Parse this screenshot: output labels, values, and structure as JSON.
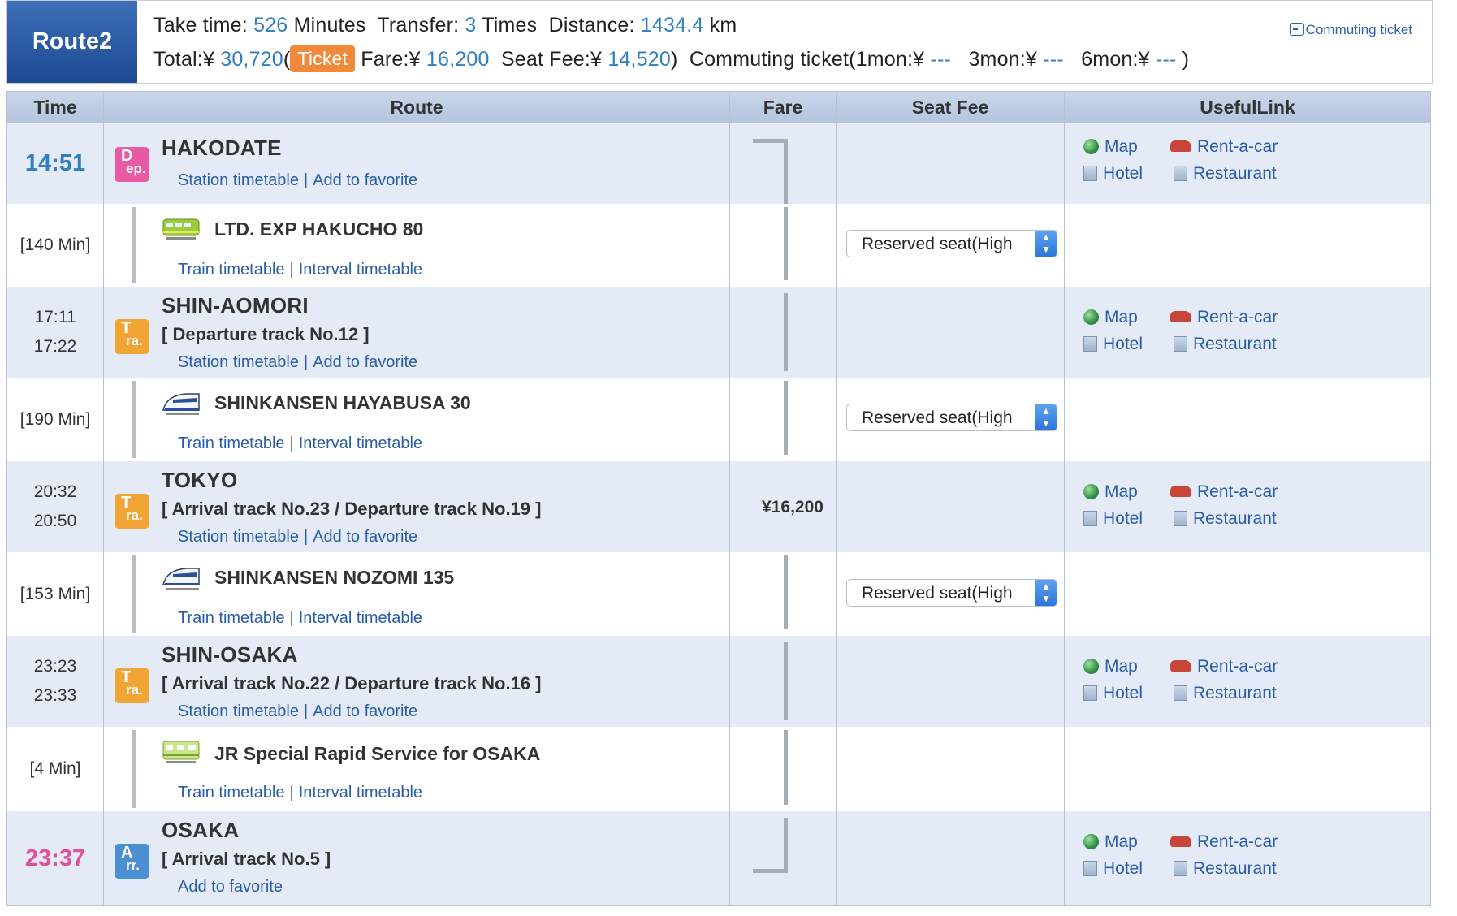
{
  "header": {
    "route_label": "Route2",
    "take_time_label": "Take time:",
    "take_time_value": "526",
    "take_time_unit": "Minutes",
    "transfer_label": "Transfer:",
    "transfer_value": "3",
    "transfer_unit": "Times",
    "distance_label": "Distance:",
    "distance_value": "1434.4",
    "distance_unit": "km",
    "total_label": "Total:¥",
    "total_value": "30,720",
    "ticket_button": "Ticket",
    "fare_label": "Fare:¥",
    "fare_value": "16,200",
    "seat_fee_label": "Seat Fee:¥",
    "seat_fee_value": "14,520",
    "commuting_prefix": "Commuting ticket(1mon:¥",
    "commuting_1mon": "---",
    "commuting_3mon_label": "3mon:¥",
    "commuting_3mon": "---",
    "commuting_6mon_label": "6mon:¥",
    "commuting_6mon": "---",
    "commuting_link": "Commuting ticket"
  },
  "columns": [
    "Time",
    "Route",
    "Fare",
    "Seat Fee",
    "UsefulLink"
  ],
  "common": {
    "station_timetable": "Station timetable",
    "add_to_favorite": "Add to favorite",
    "train_timetable": "Train timetable",
    "interval_timetable": "Interval timetable",
    "seat_option": "Reserved seat(High",
    "link_map": "Map",
    "link_rentacar": "Rent-a-car",
    "link_hotel": "Hotel",
    "link_restaurant": "Restaurant",
    "sep": "|"
  },
  "stations": [
    {
      "name": "HAKODATE",
      "badge_top": "D",
      "badge_bottom": "ep.",
      "time": "14:51"
    },
    {
      "name": "SHIN-AOMORI",
      "badge_top": "T",
      "badge_bottom": "ra.",
      "time1": "17:11",
      "time2": "17:22",
      "track": "[ Departure track No.12 ]"
    },
    {
      "name": "TOKYO",
      "badge_top": "T",
      "badge_bottom": "ra.",
      "time1": "20:32",
      "time2": "20:50",
      "track": "[ Arrival track No.23 / Departure track No.19 ]",
      "fare": "¥16,200"
    },
    {
      "name": "SHIN-OSAKA",
      "badge_top": "T",
      "badge_bottom": "ra.",
      "time1": "23:23",
      "time2": "23:33",
      "track": "[ Arrival track No.22 / Departure track No.16 ]"
    },
    {
      "name": "OSAKA",
      "badge_top": "A",
      "badge_bottom": "rr.",
      "time": "23:37",
      "track": "[ Arrival track No.5 ]"
    }
  ],
  "legs": [
    {
      "duration": "[140 Min]",
      "train": "LTD. EXP HAKUCHO 80",
      "icon": "ltd-express-train-icon"
    },
    {
      "duration": "[190 Min]",
      "train": "SHINKANSEN HAYABUSA 30",
      "icon": "shinkansen-icon"
    },
    {
      "duration": "[153 Min]",
      "train": "SHINKANSEN NOZOMI 135",
      "icon": "shinkansen-icon"
    },
    {
      "duration": "[4 Min]",
      "train": "JR Special Rapid Service  for OSAKA",
      "icon": "local-train-icon"
    }
  ],
  "colors": {
    "accent_blue": "#2f7fc1",
    "arrival_pink": "#e34f99",
    "ticket_orange": "#f08a3a",
    "station_row_bg": "#e4ebf7"
  }
}
